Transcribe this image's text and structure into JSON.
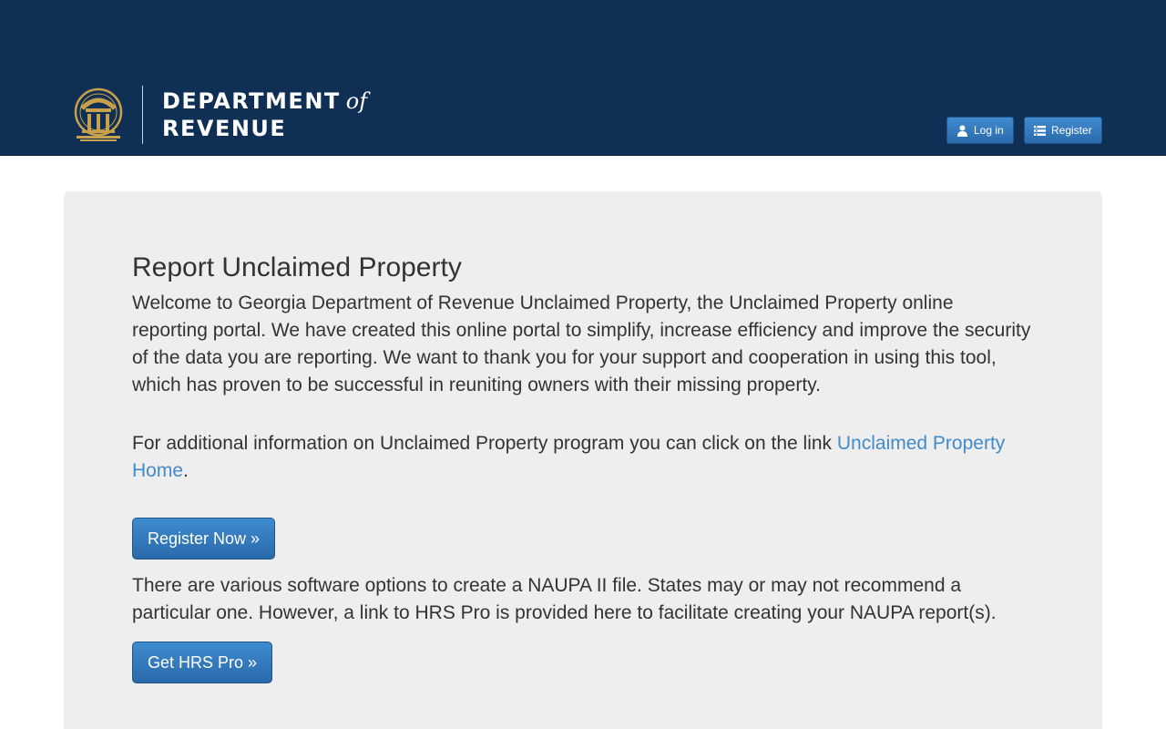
{
  "header": {
    "logo_line1": "DEPARTMENT",
    "logo_of": "of",
    "logo_line2": "REVENUE",
    "login_label": "Log in",
    "register_label": "Register"
  },
  "main": {
    "title": "Report Unclaimed Property",
    "welcome_text": "Welcome to Georgia Department of Revenue Unclaimed Property, the Unclaimed Property online reporting portal. We have created this online portal to simplify, increase efficiency and improve the security of the data you are reporting. We want to thank you for your support and cooperation in using this tool, which has proven to be successful in reuniting owners with their missing property.",
    "info_text_before": "For additional information on Unclaimed Property program you can click on the link ",
    "info_link": "Unclaimed Property Home",
    "info_text_after": ".",
    "register_now_label": "Register Now »",
    "software_text": "There are various software options to create a NAUPA II file. States may or may not recommend a particular one. However, a link to HRS Pro is provided here to facilitate creating your NAUPA report(s).",
    "get_hrs_label": "Get HRS Pro »"
  },
  "colors": {
    "header_bg": "#102f54",
    "accent": "#428bca",
    "seal_gold": "#c8a24a",
    "panel_bg": "#eeeeee"
  },
  "icons": {
    "seal": "georgia-seal-icon",
    "login": "user-icon",
    "register": "list-icon"
  }
}
